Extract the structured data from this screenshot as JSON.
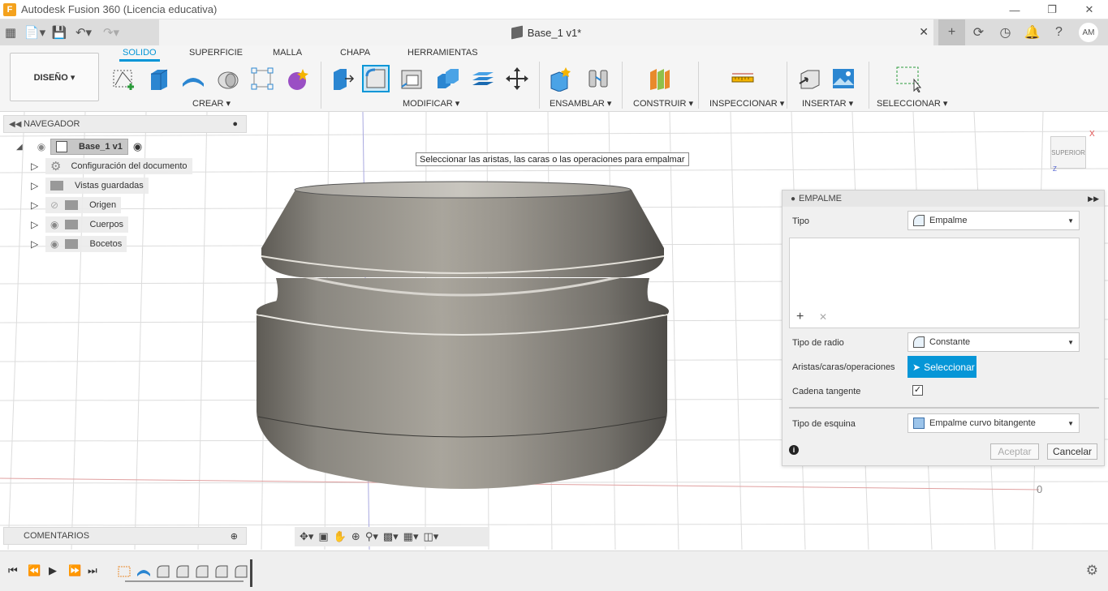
{
  "window": {
    "title": "Autodesk Fusion 360 (Licencia educativa)",
    "logo_letter": "F"
  },
  "document": {
    "title": "Base_1 v1*",
    "user_initials": "AM"
  },
  "ribbon": {
    "workspace": "DISEÑO ▾",
    "tabs": [
      "SOLIDO",
      "SUPERFICIE",
      "MALLA",
      "CHAPA",
      "HERRAMIENTAS"
    ],
    "groups": {
      "crear": "CREAR ▾",
      "modificar": "MODIFICAR ▾",
      "ensamblar": "ENSAMBLAR ▾",
      "construir": "CONSTRUIR ▾",
      "inspeccionar": "INSPECCIONAR ▾",
      "insertar": "INSERTAR ▾",
      "seleccionar": "SELECCIONAR ▾"
    }
  },
  "navigator": {
    "title": "NAVEGADOR",
    "root": "Base_1 v1",
    "items": [
      "Configuración del documento",
      "Vistas guardadas",
      "Origen",
      "Cuerpos",
      "Bocetos"
    ]
  },
  "tooltip": "Seleccionar las aristas, las caras o las operaciones para empalmar",
  "viewcube": {
    "label": "SUPERIOR",
    "axis_x": "X",
    "axis_z": "Z"
  },
  "axis_label": "0",
  "fillet_dialog": {
    "title": "EMPALME",
    "tipo_label": "Tipo",
    "tipo_value": "Empalme",
    "tipo_radio_label": "Tipo de radio",
    "tipo_radio_value": "Constante",
    "aristas_label": "Aristas/caras/operaciones",
    "select_button": "Seleccionar",
    "cadena_label": "Cadena tangente",
    "cadena_checked": true,
    "esquina_label": "Tipo de esquina",
    "esquina_value": "Empalme curvo bitangente",
    "accept": "Aceptar",
    "cancel": "Cancelar"
  },
  "comments": {
    "title": "COMENTARIOS"
  },
  "colors": {
    "accent": "#0696d7",
    "ribbon_bg": "#f5f5f5",
    "tab_bg": "#dcdcdc",
    "select_button_bg": "#0696d7"
  }
}
